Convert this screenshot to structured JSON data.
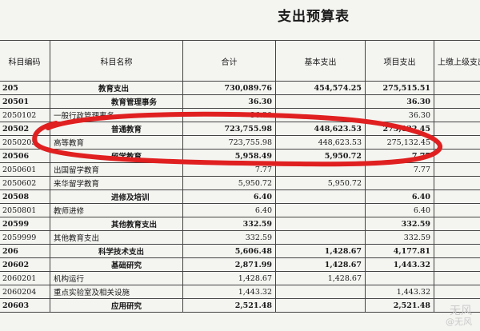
{
  "title": "支出预算表",
  "columns": [
    "科目编码",
    "科目名称",
    "合计",
    "基本支出",
    "项目支出",
    "上缴上级支出"
  ],
  "rows": [
    {
      "code": "205",
      "name": "教育支出",
      "total": "730,089.76",
      "basic": "454,574.25",
      "project": "275,515.51",
      "upper": "",
      "bold": true,
      "level": 1
    },
    {
      "code": "20501",
      "name": "教育管理事务",
      "total": "36.30",
      "basic": "",
      "project": "36.30",
      "upper": "",
      "bold": true,
      "level": 2
    },
    {
      "code": "2050102",
      "name": "一般行政管理事务",
      "total": "36.30",
      "basic": "",
      "project": "36.30",
      "upper": "",
      "bold": false,
      "level": 3
    },
    {
      "code": "20502",
      "name": "普通教育",
      "total": "723,755.98",
      "basic": "448,623.53",
      "project": "275,132.45",
      "upper": "",
      "bold": true,
      "level": 2
    },
    {
      "code": "2050205",
      "name": "高等教育",
      "total": "723,755.98",
      "basic": "448,623.53",
      "project": "275,132.45",
      "upper": "",
      "bold": false,
      "level": 3
    },
    {
      "code": "20506",
      "name": "留学教育",
      "total": "5,958.49",
      "basic": "5,950.72",
      "project": "7.77",
      "upper": "",
      "bold": true,
      "level": 2
    },
    {
      "code": "2050601",
      "name": "出国留学教育",
      "total": "7.77",
      "basic": "",
      "project": "7.77",
      "upper": "",
      "bold": false,
      "level": 3
    },
    {
      "code": "2050602",
      "name": "来华留学教育",
      "total": "5,950.72",
      "basic": "5,950.72",
      "project": "",
      "upper": "",
      "bold": false,
      "level": 3
    },
    {
      "code": "20508",
      "name": "进修及培训",
      "total": "6.40",
      "basic": "",
      "project": "6.40",
      "upper": "",
      "bold": true,
      "level": 2
    },
    {
      "code": "2050801",
      "name": "教师进修",
      "total": "6.40",
      "basic": "",
      "project": "6.40",
      "upper": "",
      "bold": false,
      "level": 3
    },
    {
      "code": "20599",
      "name": "其他教育支出",
      "total": "332.59",
      "basic": "",
      "project": "332.59",
      "upper": "",
      "bold": true,
      "level": 2
    },
    {
      "code": "2059999",
      "name": "其他教育支出",
      "total": "332.59",
      "basic": "",
      "project": "332.59",
      "upper": "",
      "bold": false,
      "level": 3
    },
    {
      "code": "206",
      "name": "科学技术支出",
      "total": "5,606.48",
      "basic": "1,428.67",
      "project": "4,177.81",
      "upper": "",
      "bold": true,
      "level": 1
    },
    {
      "code": "20602",
      "name": "基础研究",
      "total": "2,871.99",
      "basic": "1,428.67",
      "project": "1,443.32",
      "upper": "",
      "bold": true,
      "level": 2
    },
    {
      "code": "2060201",
      "name": "机构运行",
      "total": "1,428.67",
      "basic": "1,428.67",
      "project": "",
      "upper": "",
      "bold": false,
      "level": 3
    },
    {
      "code": "2060204",
      "name": "重点实验室及相关设施",
      "total": "1,443.32",
      "basic": "",
      "project": "1,443.32",
      "upper": "",
      "bold": false,
      "level": 3
    },
    {
      "code": "20603",
      "name": "应用研究",
      "total": "2,521.48",
      "basic": "",
      "project": "2,521.48",
      "upper": "",
      "bold": true,
      "level": 2
    }
  ],
  "watermark": {
    "line1": "无风",
    "line2": "@无风"
  },
  "colors": {
    "highlight_ellipse": "#e02020"
  }
}
